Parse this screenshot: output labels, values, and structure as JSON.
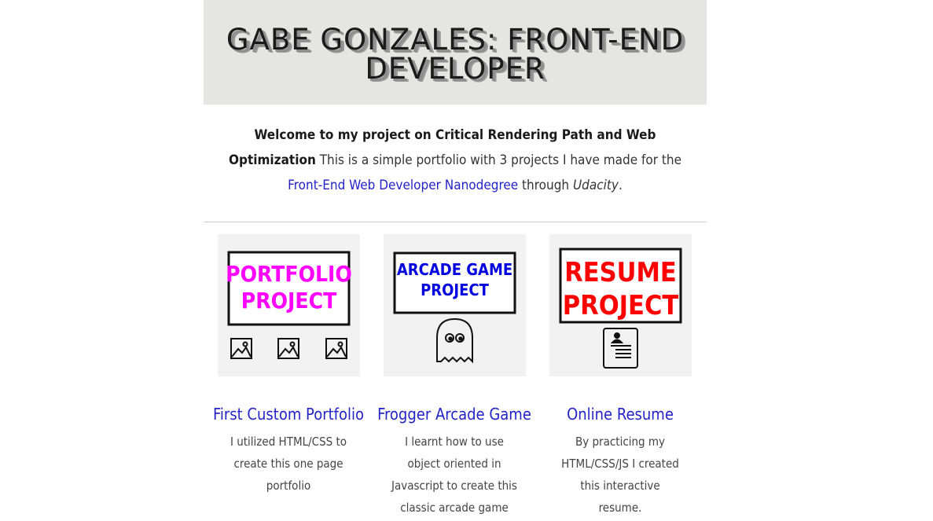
{
  "header": {
    "title": "GABE GONZALES: FRONT-END DEVELOPER"
  },
  "intro": {
    "bold": "Welcome to my project on Critical Rendering Path and Web Optimization",
    "text1": " This is a simple portfolio with 3 projects I have made for the ",
    "link": "Front-End Web Developer Nanodegree",
    "text2": " through ",
    "em": "Udacity",
    "text3": "."
  },
  "projects": [
    {
      "sign_line1": "PORTFOLIO",
      "sign_line2": "PROJECT",
      "sign_color": "#ff00ff",
      "title": "First Custom Portfolio",
      "desc": "I utilized HTML/CSS to create this one page portfolio"
    },
    {
      "sign_line1": "ARCADE GAME",
      "sign_line2": "PROJECT",
      "sign_color": "#0000e0",
      "title": "Frogger Arcade Game",
      "desc": "I learnt how to use object oriented in Javascript to create this classic arcade game"
    },
    {
      "sign_line1": "RESUME",
      "sign_line2": "PROJECT",
      "sign_color": "#ff0000",
      "title": "Online Resume",
      "desc": "By practicing my HTML/CSS/JS I created this interactive resume."
    }
  ],
  "colors": {
    "link": "#2323c8",
    "header_bg": "#e5e5e3"
  }
}
